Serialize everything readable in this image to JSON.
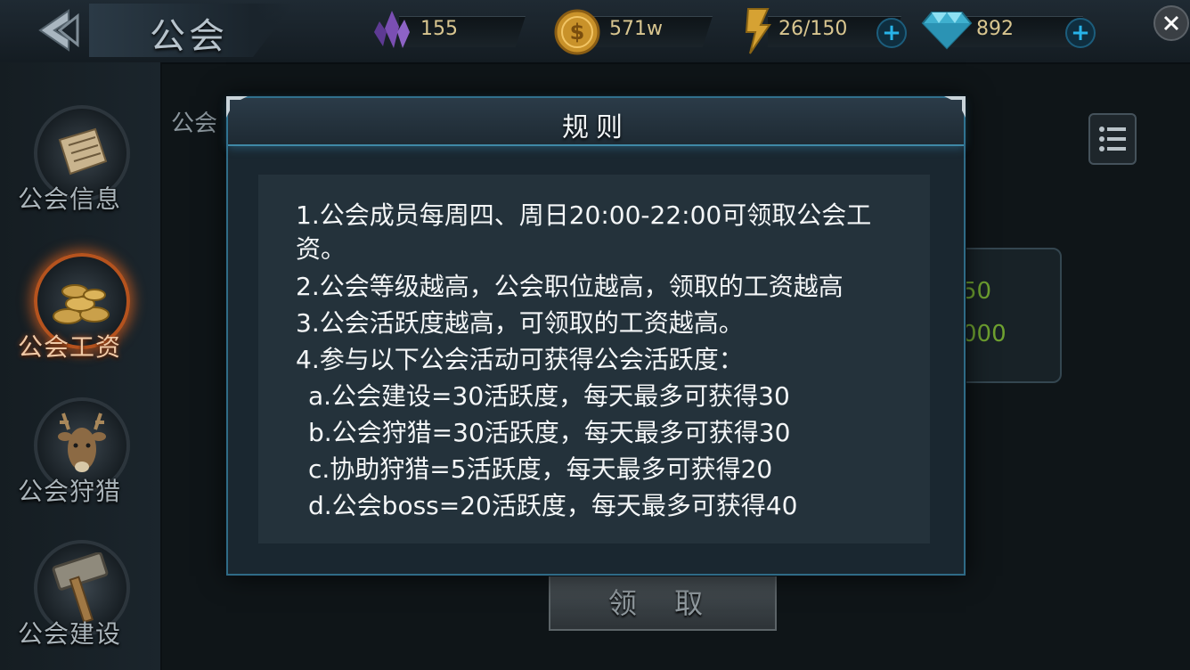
{
  "header": {
    "title": "公会",
    "resources": [
      {
        "name": "crystal",
        "icon": "purple-crystal-icon",
        "value": "155"
      },
      {
        "name": "gold",
        "icon": "gold-coin-icon",
        "value": "571w"
      },
      {
        "name": "stamina",
        "icon": "lightning-icon",
        "value": "26/150"
      },
      {
        "name": "diamond",
        "icon": "diamond-icon",
        "value": "892"
      }
    ]
  },
  "sidebar": {
    "items": [
      {
        "label": "公会信息",
        "icon": "scroll-icon",
        "active": false
      },
      {
        "label": "公会工资",
        "icon": "coins-icon",
        "active": true
      },
      {
        "label": "公会狩猎",
        "icon": "deer-icon",
        "active": false
      },
      {
        "label": "公会建设",
        "icon": "hammer-icon",
        "active": false
      }
    ]
  },
  "background": {
    "tab_label": "公会",
    "values": [
      "50",
      "000"
    ],
    "claim_button": "领 取"
  },
  "dialog": {
    "title": "规则",
    "lines": [
      "1.公会成员每周四、周日20:00-22:00可领取公会工",
      "资。",
      "2.公会等级越高，公会职位越高，领取的工资越高",
      "3.公会活跃度越高，可领取的工资越高。",
      "4.参与以下公会活动可获得公会活跃度：",
      "a.公会建设=30活跃度，每天最多可获得30",
      "b.公会狩猎=30活跃度，每天最多可获得30",
      "c.协助狩猎=5活跃度，每天最多可获得20",
      "d.公会boss=20活跃度，每天最多可获得40"
    ]
  },
  "colors": {
    "accent_blue": "#3f88a6",
    "resource_text": "#d9c690",
    "active_glow": "#de621e",
    "green_value": "#6fa230"
  }
}
